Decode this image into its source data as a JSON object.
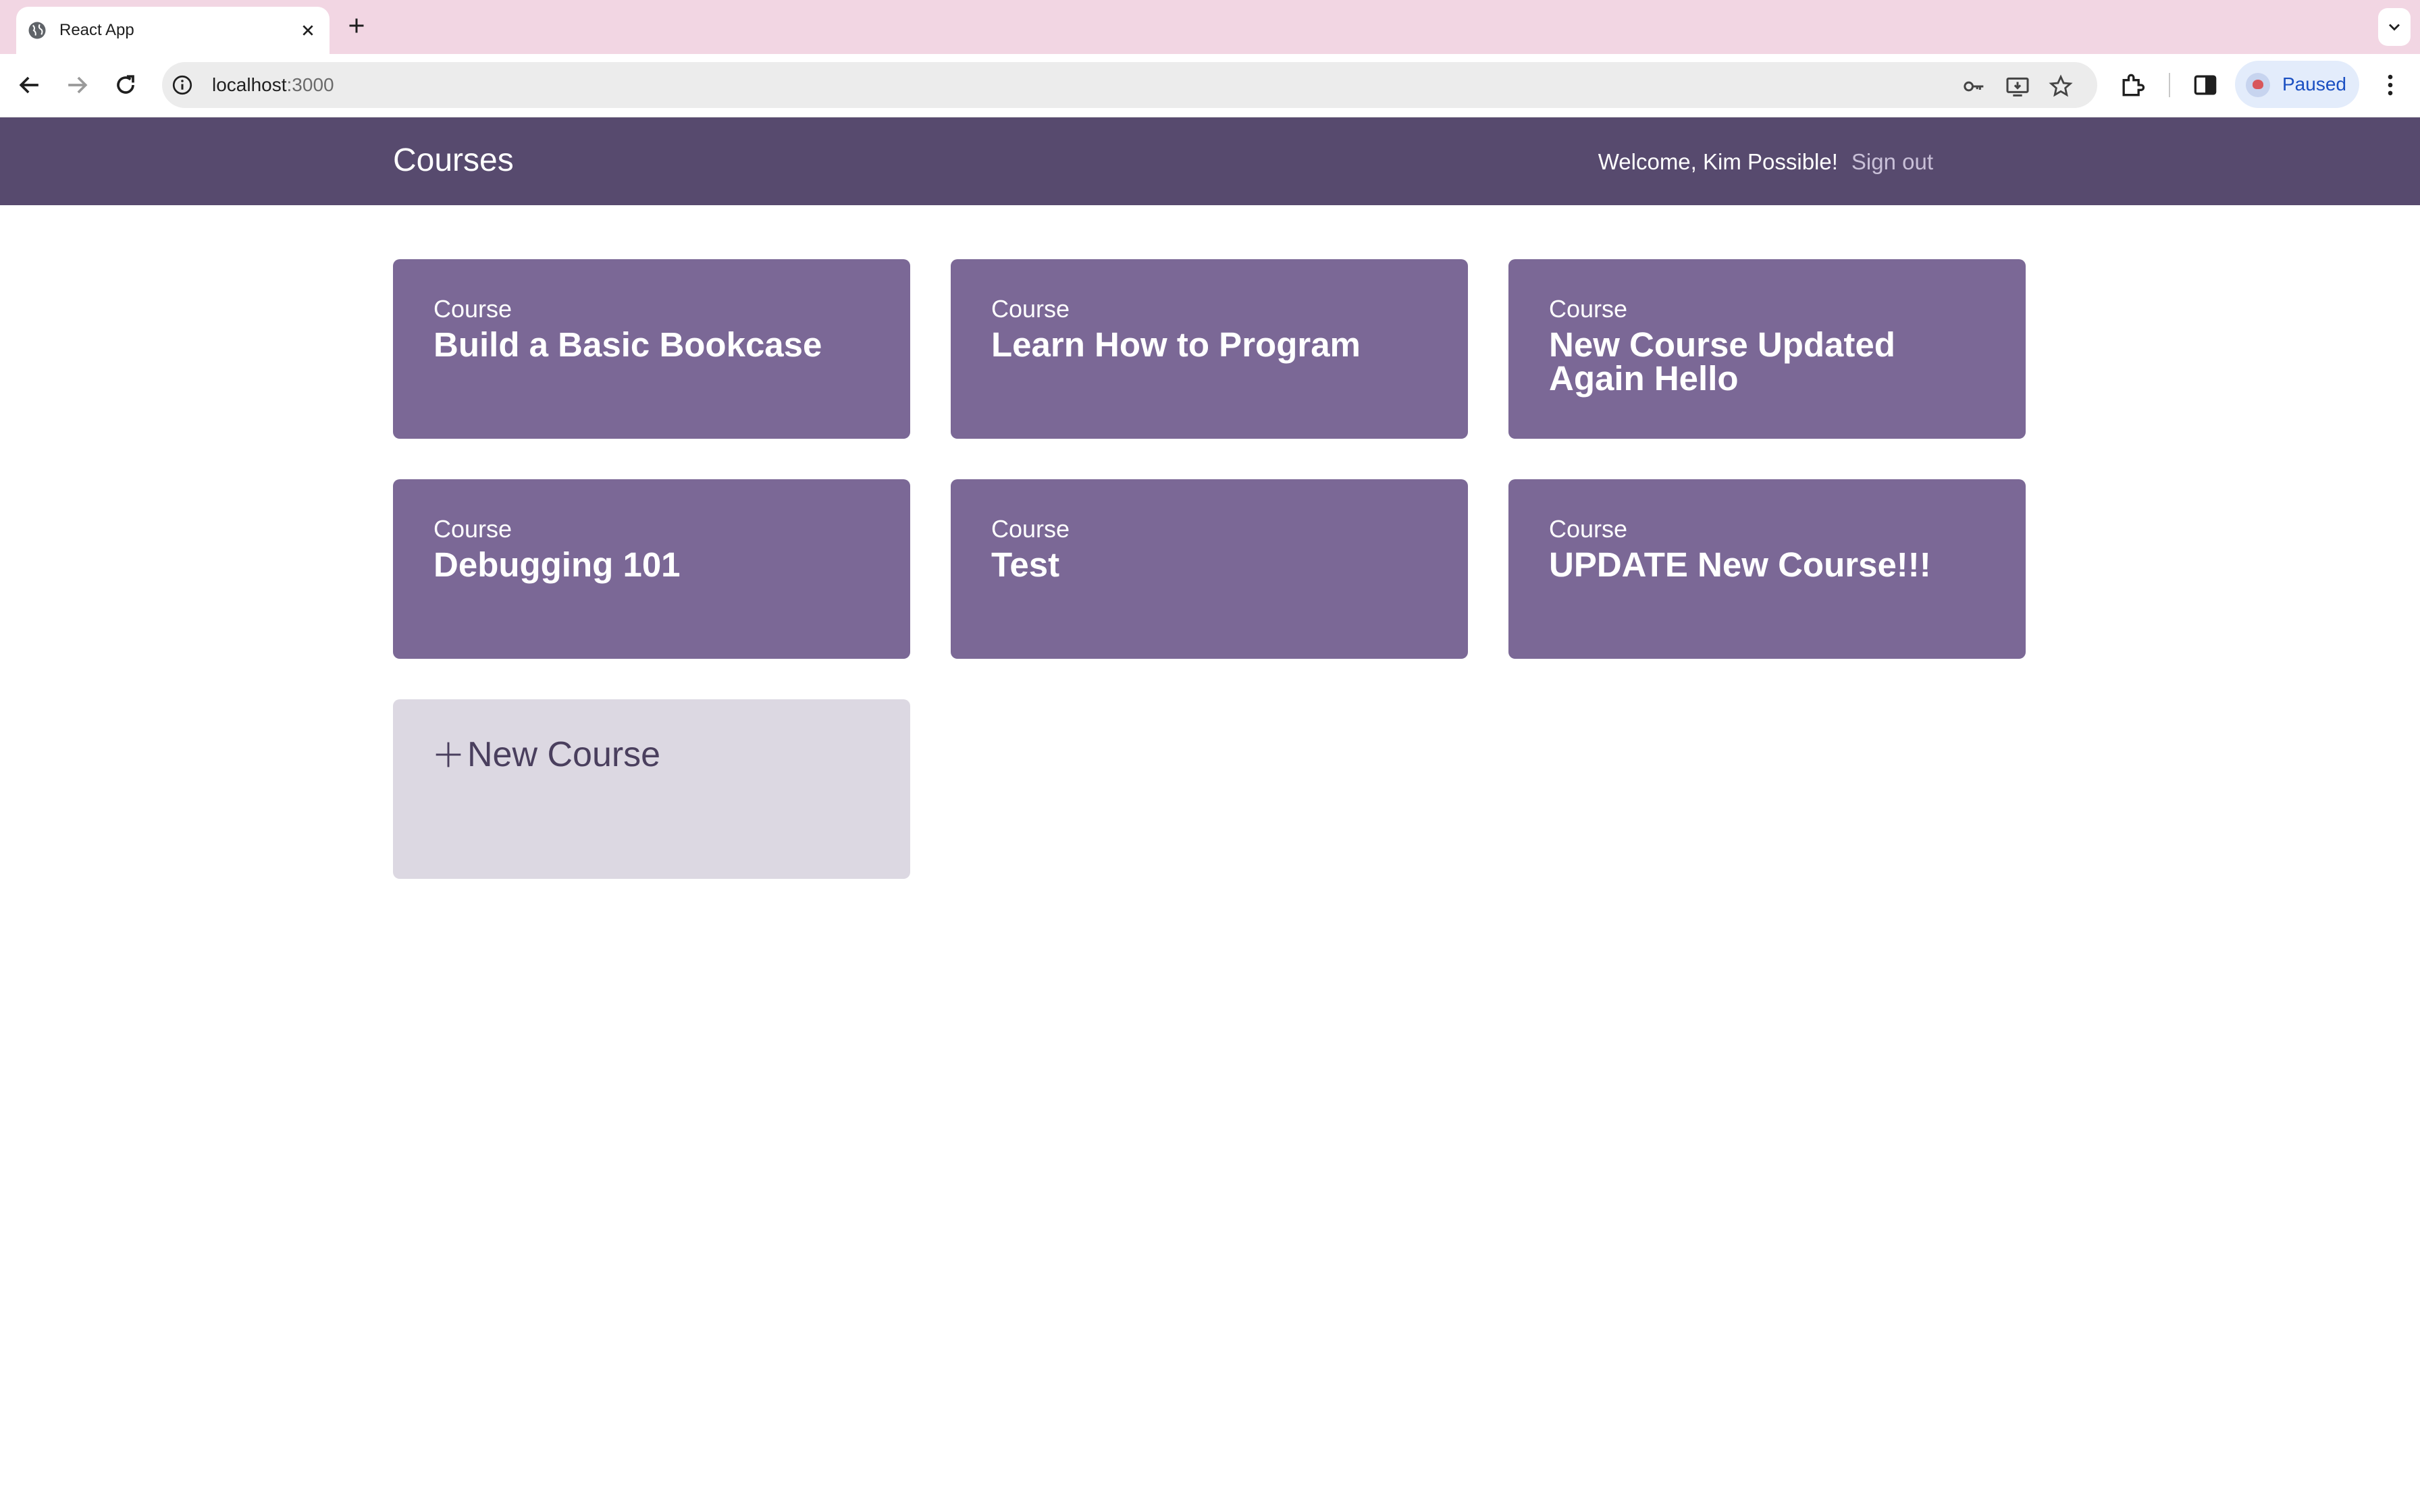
{
  "browser": {
    "tab_title": "React App",
    "url_host": "localhost",
    "url_port": ":3000",
    "profile_status": "Paused"
  },
  "header": {
    "title": "Courses",
    "welcome": "Welcome, Kim Possible!",
    "signout": "Sign out"
  },
  "courses": [
    {
      "kind": "Course",
      "title": "Build a Basic Bookcase"
    },
    {
      "kind": "Course",
      "title": "Learn How to Program"
    },
    {
      "kind": "Course",
      "title": "New Course Updated Again Hello"
    },
    {
      "kind": "Course",
      "title": "Debugging 101"
    },
    {
      "kind": "Course",
      "title": "Test"
    },
    {
      "kind": "Course",
      "title": "UPDATE New Course!!!"
    }
  ],
  "new_course": {
    "label": "New Course"
  },
  "colors": {
    "header_bg": "#574a6e",
    "card_bg": "#7b6896",
    "new_card_bg": "#dcd8e2",
    "tabstrip_bg": "#f2d6e3"
  }
}
